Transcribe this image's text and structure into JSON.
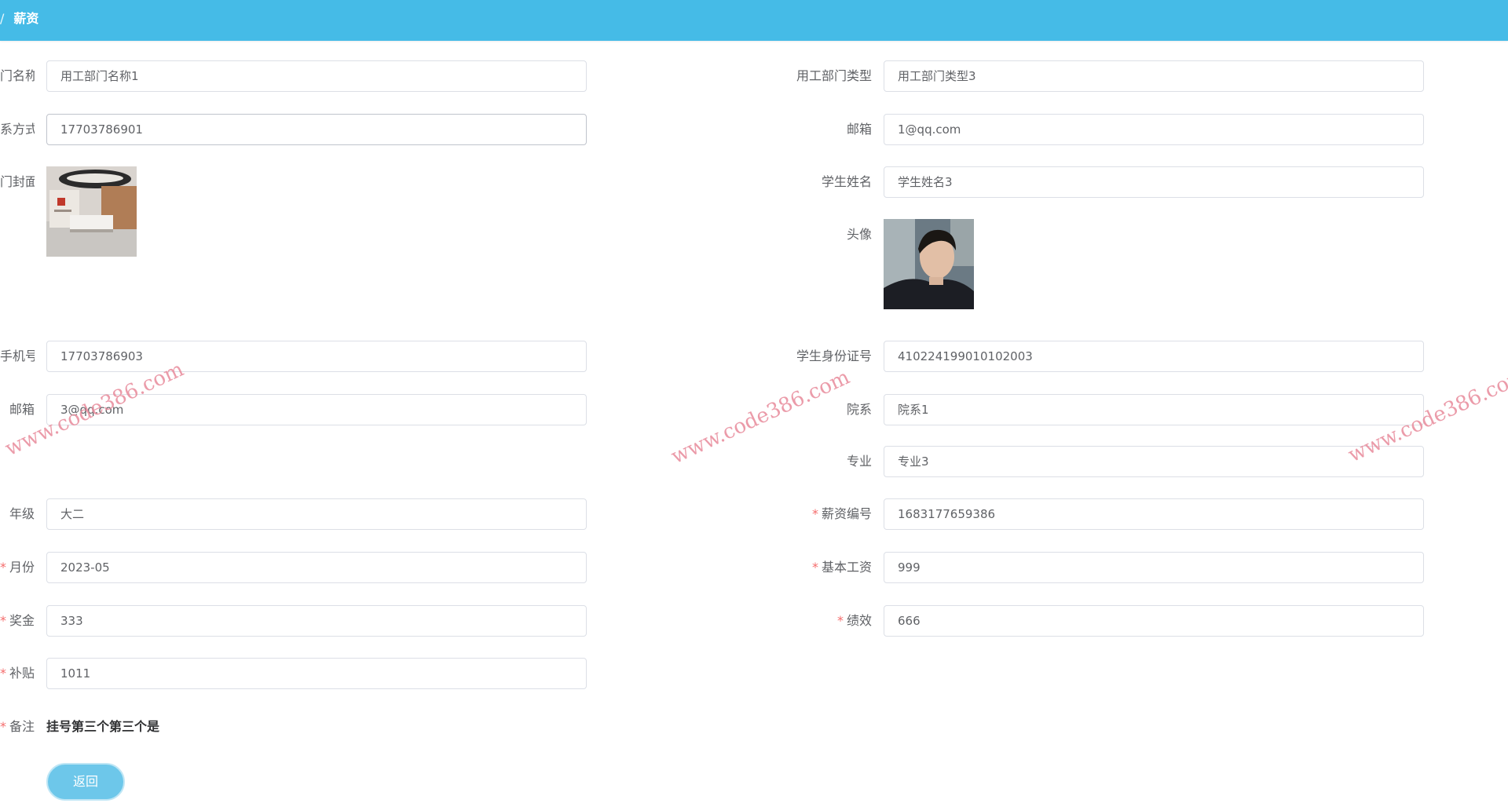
{
  "breadcrumb": {
    "separator": "/",
    "current": "薪资"
  },
  "fields": {
    "dept_name": {
      "label": "门名称",
      "value": "用工部门名称1"
    },
    "dept_type": {
      "label": "用工部门类型",
      "value": "用工部门类型3"
    },
    "contact": {
      "label": "系方式",
      "value": "17703786901"
    },
    "dept_email": {
      "label": "邮箱",
      "value": "1@qq.com"
    },
    "dept_cover": {
      "label": "门封面"
    },
    "student_name": {
      "label": "学生姓名",
      "value": "学生姓名3"
    },
    "avatar": {
      "label": "头像"
    },
    "phone": {
      "label": "手机号",
      "value": "17703786903"
    },
    "student_id_card": {
      "label": "学生身份证号",
      "value": "410224199010102003"
    },
    "student_email": {
      "label": "邮箱",
      "value": "3@qq.com"
    },
    "college": {
      "label": "院系",
      "value": "院系1"
    },
    "major": {
      "label": "专业",
      "value": "专业3"
    },
    "grade": {
      "label": "年级",
      "value": "大二"
    },
    "salary_no": {
      "label": "薪资编号",
      "value": "1683177659386",
      "required": "*"
    },
    "month": {
      "label": "月份",
      "value": "2023-05",
      "required": "*"
    },
    "base_salary": {
      "label": "基本工资",
      "value": "999",
      "required": "*"
    },
    "bonus": {
      "label": "奖金",
      "value": "333",
      "required": "*"
    },
    "performance": {
      "label": "绩效",
      "value": "666",
      "required": "*"
    },
    "allowance": {
      "label": "补贴",
      "value": "1011",
      "required": "*"
    },
    "remark": {
      "label": "备注",
      "value": "挂号第三个第三个是",
      "required": "*"
    }
  },
  "actions": {
    "back_label": "返回"
  },
  "watermark": "www.code386.com",
  "colors": {
    "header": "#45bbe7",
    "button": "#6dc7ea",
    "required": "#f56c6c"
  }
}
